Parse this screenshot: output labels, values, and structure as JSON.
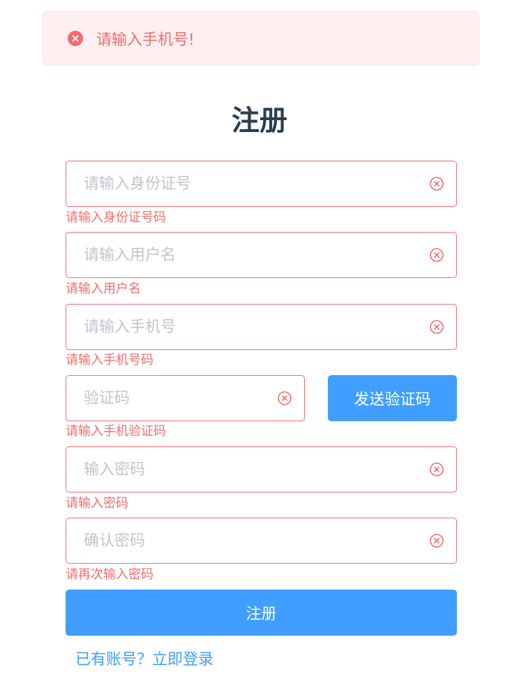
{
  "alert": {
    "icon": "circle-close-icon",
    "message": "请输入手机号!"
  },
  "page_title": "注册",
  "form": {
    "id_number": {
      "placeholder": "请输入身份证号",
      "value": "",
      "error": "请输入身份证号码"
    },
    "username": {
      "placeholder": "请输入用户名",
      "value": "",
      "error": "请输入用户名"
    },
    "phone": {
      "placeholder": "请输入手机号",
      "value": "",
      "error": "请输入手机号码"
    },
    "sms_code": {
      "placeholder": "验证码",
      "value": "",
      "error": "请输入手机验证码"
    },
    "send_code_label": "发送验证码",
    "password": {
      "placeholder": "输入密码",
      "value": "",
      "error": "请输入密码"
    },
    "confirm_password": {
      "placeholder": "确认密码",
      "value": "",
      "error": "请再次输入密码"
    },
    "submit_label": "注册",
    "login_link": "已有账号？立即登录"
  },
  "colors": {
    "primary": "#409eff",
    "danger": "#f56c6c",
    "alert_bg": "#fef0f0",
    "title": "#2c3e50",
    "placeholder": "#c0c4cc"
  }
}
